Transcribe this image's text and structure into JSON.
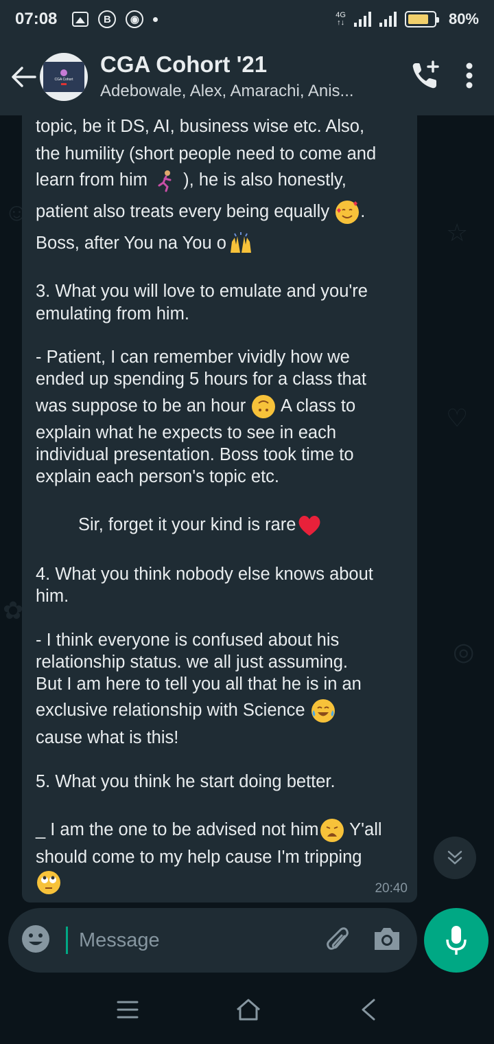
{
  "status_bar": {
    "time": "07:08",
    "network": "4G",
    "battery_percent": "80%",
    "battery_level": 0.8
  },
  "header": {
    "title": "CGA Cohort '21",
    "subtitle": "Adebowale, Alex, Amarachi, Anis...",
    "icons": [
      "back-arrow-icon",
      "group-avatar",
      "add-call-icon",
      "more-options-icon"
    ]
  },
  "message": {
    "lines": [
      "topic, be it DS, AI, business wise etc. Also,",
      "the humility (short people need to come and",
      "learn from him",
      "), he is also honestly,",
      "patient also treats every being equally",
      ".",
      "Boss, after You na You o",
      "3. What you will love to emulate and you're",
      "emulating from him.",
      "- Patient, I can remember vividly how we",
      "ended up spending 5 hours for a class that",
      "was suppose to be an hour",
      "A class to",
      "explain what he expects to see in each",
      "individual presentation. Boss took time to",
      "explain each person's topic etc.",
      "Sir, forget it your kind is rare",
      "4. What you think nobody else knows about",
      "him.",
      "- I think everyone is confused about his",
      "relationship status. we all just assuming.",
      "But I am here to tell you all that he is in an",
      "exclusive relationship with Science",
      "cause what is this!",
      "5. What you think he start doing better.",
      "_ I am the one to be advised not him",
      "Y'all",
      "should come to my help cause I'm tripping"
    ],
    "time": "20:40"
  },
  "composer": {
    "placeholder": "Message"
  }
}
